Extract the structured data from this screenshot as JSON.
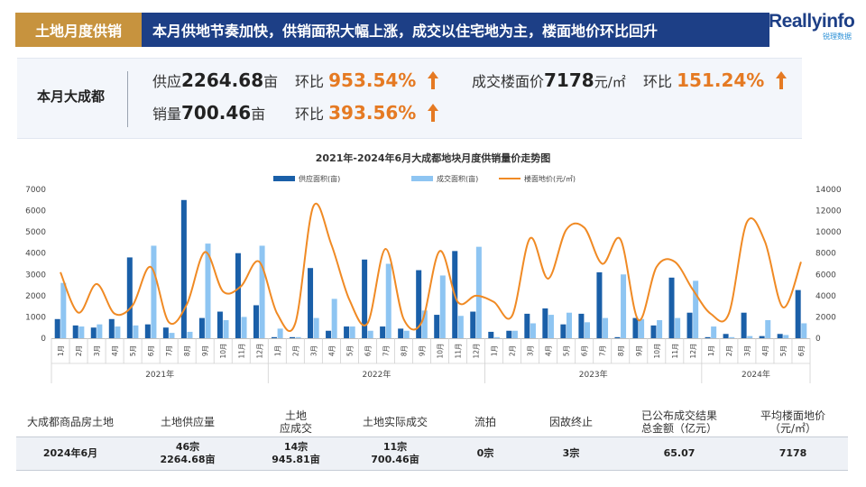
{
  "header": {
    "badge": "土地月度供销",
    "title": "本月供地节奏加快，供销面积大幅上涨，成交以住宅地为主，楼面地价环比回升",
    "logo_text": "Reallyinfo",
    "logo_sub": "锐理数据"
  },
  "summary": {
    "label": "本月大成都",
    "supply_prefix": "供应",
    "supply_value": "2264.68",
    "supply_unit": "亩",
    "supply_mom_label": "环比",
    "supply_mom": "953.54%",
    "sales_prefix": "销量",
    "sales_value": "700.46",
    "sales_unit": "亩",
    "sales_mom_label": "环比",
    "sales_mom": "393.56%",
    "price_prefix": "成交楼面价",
    "price_value": "7178",
    "price_unit": "元/㎡",
    "price_mom_label": "环比",
    "price_mom": "151.24%",
    "accent_color": "#e57a23"
  },
  "chart_data": {
    "type": "bar",
    "title": "2021年-2024年6月大成都地块月度供销量价走势图",
    "legend": [
      "供应面积(亩)",
      "成交面积(亩)",
      "楼面地价(元/㎡)"
    ],
    "legend_placement": "top-center",
    "colors": {
      "supply": "#1a5fa8",
      "sales": "#8ec5f2",
      "price": "#f08a24"
    },
    "ylim_left": [
      0,
      7000
    ],
    "yticks_left": [
      0,
      1000,
      2000,
      3000,
      4000,
      5000,
      6000,
      7000
    ],
    "ylim_right": [
      0,
      14000
    ],
    "yticks_right": [
      0,
      2000,
      4000,
      6000,
      8000,
      10000,
      12000,
      14000
    ],
    "months": [
      "1月",
      "2月",
      "3月",
      "4月",
      "5月",
      "6月",
      "7月",
      "8月",
      "9月",
      "10月",
      "11月",
      "12月",
      "1月",
      "2月",
      "3月",
      "4月",
      "5月",
      "6月",
      "7月",
      "8月",
      "9月",
      "10月",
      "11月",
      "12月",
      "1月",
      "2月",
      "3月",
      "4月",
      "5月",
      "6月",
      "7月",
      "8月",
      "9月",
      "10月",
      "11月",
      "12月",
      "1月",
      "2月",
      "3月",
      "4月",
      "5月",
      "6月"
    ],
    "years": [
      {
        "label": "2021年",
        "count": 12
      },
      {
        "label": "2022年",
        "count": 12
      },
      {
        "label": "2023年",
        "count": 12
      },
      {
        "label": "2024年",
        "count": 6
      }
    ],
    "series": [
      {
        "name": "供应面积(亩)",
        "axis": "left",
        "kind": "bar",
        "values": [
          900,
          600,
          500,
          900,
          3800,
          650,
          500,
          6500,
          950,
          1250,
          4000,
          1550,
          50,
          50,
          3300,
          350,
          550,
          3700,
          550,
          450,
          3200,
          1100,
          4100,
          1250,
          300,
          350,
          1150,
          1400,
          650,
          1150,
          3100,
          50,
          950,
          600,
          2850,
          1200,
          50,
          200,
          1200,
          100,
          200,
          2264.68
        ]
      },
      {
        "name": "成交面积(亩)",
        "axis": "left",
        "kind": "bar",
        "values": [
          2600,
          550,
          650,
          550,
          600,
          4350,
          250,
          300,
          4450,
          850,
          1000,
          4350,
          450,
          50,
          950,
          1850,
          550,
          350,
          3500,
          350,
          1300,
          2950,
          1050,
          4300,
          50,
          350,
          700,
          1100,
          1200,
          750,
          950,
          3000,
          900,
          850,
          950,
          2700,
          550,
          50,
          100,
          850,
          150,
          700.46
        ]
      },
      {
        "name": "楼面地价(元/㎡)",
        "axis": "right",
        "kind": "line",
        "values": [
          6200,
          2400,
          5100,
          2300,
          3100,
          6700,
          1500,
          3200,
          8100,
          4400,
          4900,
          7200,
          2300,
          1400,
          12400,
          8800,
          3600,
          1400,
          8400,
          1800,
          1500,
          8200,
          3400,
          4000,
          3400,
          2100,
          9400,
          5600,
          10200,
          10400,
          7000,
          9300,
          1700,
          6700,
          7200,
          4600,
          2300,
          2300,
          10900,
          9100,
          2900,
          7178
        ]
      }
    ]
  },
  "table": {
    "headers": [
      "大成都商品房土地",
      "土地供应量",
      "土地\n应成交",
      "土地实际成交",
      "流拍",
      "因故终止",
      "已公布成交结果\n总金额（亿元）",
      "平均楼面地价\n（元/㎡）"
    ],
    "row": [
      "2024年6月",
      "46宗\n2264.68亩",
      "14宗\n945.81亩",
      "11宗\n700.46亩",
      "0宗",
      "3宗",
      "65.07",
      "7178"
    ]
  }
}
